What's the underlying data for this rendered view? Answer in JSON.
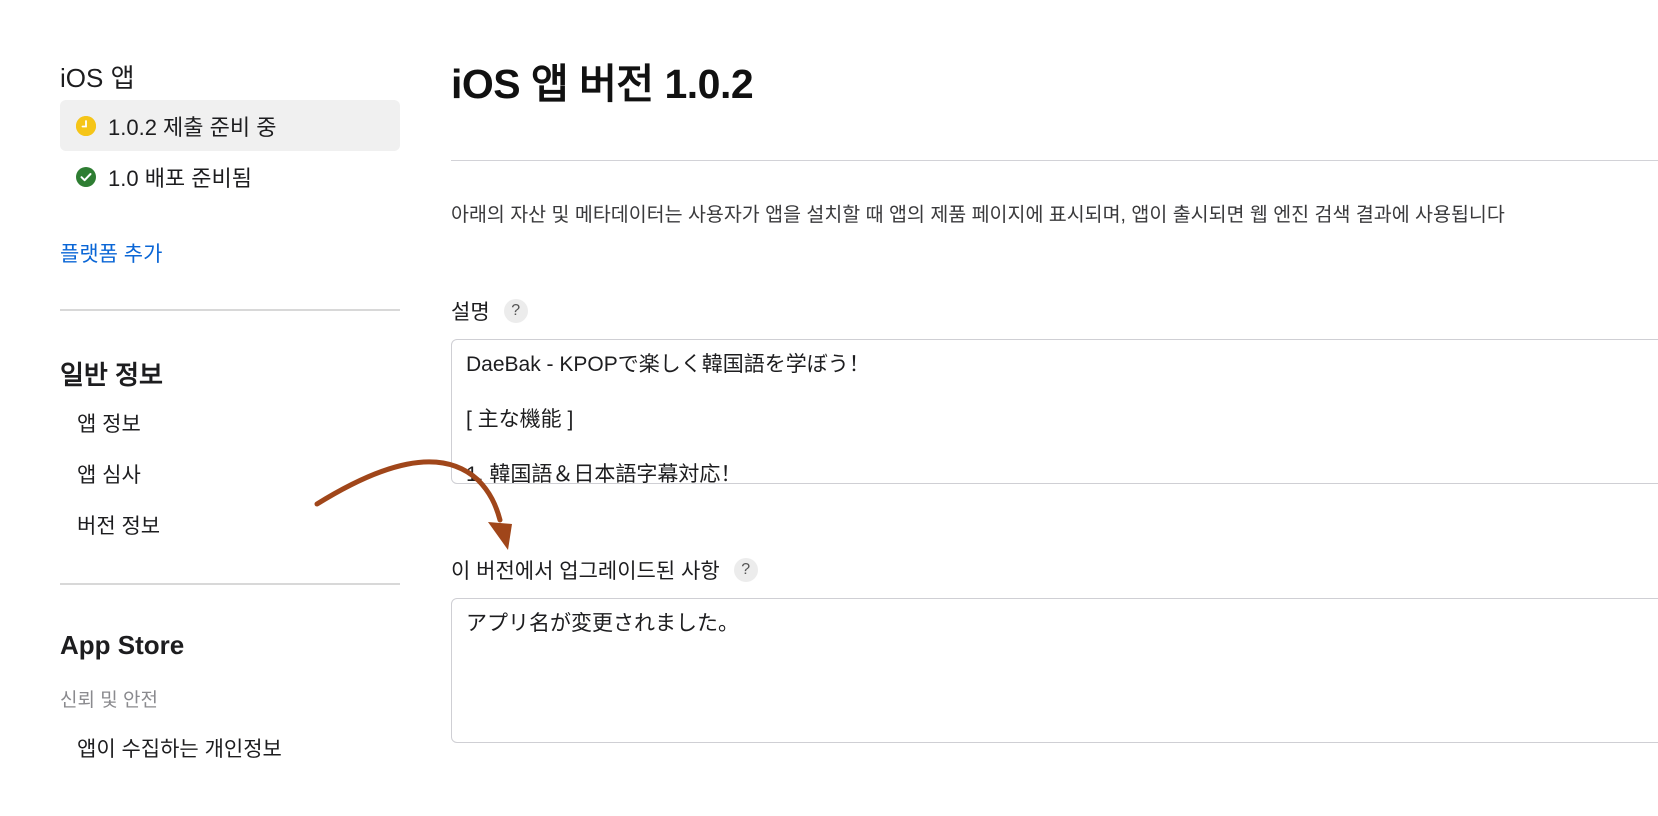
{
  "sidebar": {
    "ios_section_title": "iOS 앱",
    "versions": [
      {
        "label": "1.0.2 제출 준비 중",
        "status": "pending",
        "color": "#f5c518",
        "selected": true
      },
      {
        "label": "1.0 배포 준비됨",
        "status": "ready",
        "color": "#2e7d32",
        "selected": false
      }
    ],
    "add_platform_link": "플랫폼 추가",
    "general_section_title": "일반 정보",
    "general_items": [
      "앱 정보",
      "앱 심사",
      "버전 정보"
    ],
    "appstore_section_title": "App Store",
    "trust_subheading": "신뢰 및 안전",
    "trust_items": [
      "앱이 수집하는 개인정보"
    ]
  },
  "main": {
    "title": "iOS 앱 버전 1.0.2",
    "intro": "아래의 자산 및 메타데이터는 사용자가 앱을 설치할 때 앱의 제품 페이지에 표시되며, 앱이 출시되면 웹 엔진 검색 결과에 사용됩니다",
    "description_label": "설명",
    "description_lines": [
      "DaeBak - KPOPで楽しく韓国語を学ぼう！",
      "[ 主な機能 ]",
      "1.  韓国語＆日本語字幕対応！"
    ],
    "whats_new_label": "이 버전에서 업그레이드된 사항",
    "whats_new_text": "アプリ名が変更されました。",
    "help_glyph": "?"
  },
  "colors": {
    "accent_link": "#0a66d6",
    "annotation_arrow": "#a0461a",
    "pending": "#f5c518",
    "ready": "#2e7d32"
  }
}
